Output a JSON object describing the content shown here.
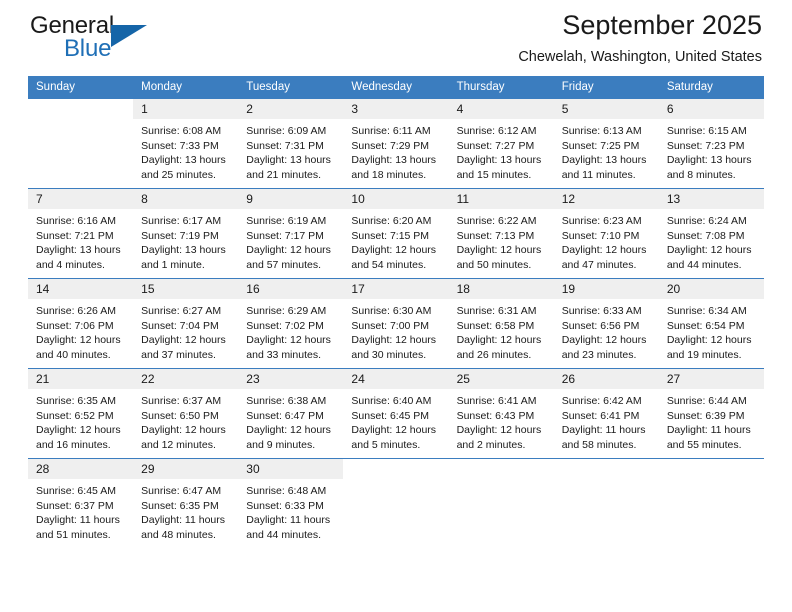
{
  "brand": {
    "name_part1": "General",
    "name_part2": "Blue",
    "logo_icon": "triangle-icon",
    "accent_color": "#1f6fb6"
  },
  "header": {
    "title": "September 2025",
    "subtitle": "Chewelah, Washington, United States"
  },
  "theme": {
    "header_blue": "#3b7dbf",
    "daynum_band": "#efefef",
    "text": "#1a1a1a"
  },
  "weekdays": [
    "Sunday",
    "Monday",
    "Tuesday",
    "Wednesday",
    "Thursday",
    "Friday",
    "Saturday"
  ],
  "labels": {
    "sunrise_prefix": "Sunrise:",
    "sunset_prefix": "Sunset:",
    "daylight_prefix": "Daylight:"
  },
  "weeks": [
    [
      {
        "day": "",
        "empty": true
      },
      {
        "day": "1",
        "sunrise": "Sunrise: 6:08 AM",
        "sunset": "Sunset: 7:33 PM",
        "daylight_line1": "Daylight: 13 hours",
        "daylight_line2": "and 25 minutes."
      },
      {
        "day": "2",
        "sunrise": "Sunrise: 6:09 AM",
        "sunset": "Sunset: 7:31 PM",
        "daylight_line1": "Daylight: 13 hours",
        "daylight_line2": "and 21 minutes."
      },
      {
        "day": "3",
        "sunrise": "Sunrise: 6:11 AM",
        "sunset": "Sunset: 7:29 PM",
        "daylight_line1": "Daylight: 13 hours",
        "daylight_line2": "and 18 minutes."
      },
      {
        "day": "4",
        "sunrise": "Sunrise: 6:12 AM",
        "sunset": "Sunset: 7:27 PM",
        "daylight_line1": "Daylight: 13 hours",
        "daylight_line2": "and 15 minutes."
      },
      {
        "day": "5",
        "sunrise": "Sunrise: 6:13 AM",
        "sunset": "Sunset: 7:25 PM",
        "daylight_line1": "Daylight: 13 hours",
        "daylight_line2": "and 11 minutes."
      },
      {
        "day": "6",
        "sunrise": "Sunrise: 6:15 AM",
        "sunset": "Sunset: 7:23 PM",
        "daylight_line1": "Daylight: 13 hours",
        "daylight_line2": "and 8 minutes."
      }
    ],
    [
      {
        "day": "7",
        "sunrise": "Sunrise: 6:16 AM",
        "sunset": "Sunset: 7:21 PM",
        "daylight_line1": "Daylight: 13 hours",
        "daylight_line2": "and 4 minutes."
      },
      {
        "day": "8",
        "sunrise": "Sunrise: 6:17 AM",
        "sunset": "Sunset: 7:19 PM",
        "daylight_line1": "Daylight: 13 hours",
        "daylight_line2": "and 1 minute."
      },
      {
        "day": "9",
        "sunrise": "Sunrise: 6:19 AM",
        "sunset": "Sunset: 7:17 PM",
        "daylight_line1": "Daylight: 12 hours",
        "daylight_line2": "and 57 minutes."
      },
      {
        "day": "10",
        "sunrise": "Sunrise: 6:20 AM",
        "sunset": "Sunset: 7:15 PM",
        "daylight_line1": "Daylight: 12 hours",
        "daylight_line2": "and 54 minutes."
      },
      {
        "day": "11",
        "sunrise": "Sunrise: 6:22 AM",
        "sunset": "Sunset: 7:13 PM",
        "daylight_line1": "Daylight: 12 hours",
        "daylight_line2": "and 50 minutes."
      },
      {
        "day": "12",
        "sunrise": "Sunrise: 6:23 AM",
        "sunset": "Sunset: 7:10 PM",
        "daylight_line1": "Daylight: 12 hours",
        "daylight_line2": "and 47 minutes."
      },
      {
        "day": "13",
        "sunrise": "Sunrise: 6:24 AM",
        "sunset": "Sunset: 7:08 PM",
        "daylight_line1": "Daylight: 12 hours",
        "daylight_line2": "and 44 minutes."
      }
    ],
    [
      {
        "day": "14",
        "sunrise": "Sunrise: 6:26 AM",
        "sunset": "Sunset: 7:06 PM",
        "daylight_line1": "Daylight: 12 hours",
        "daylight_line2": "and 40 minutes."
      },
      {
        "day": "15",
        "sunrise": "Sunrise: 6:27 AM",
        "sunset": "Sunset: 7:04 PM",
        "daylight_line1": "Daylight: 12 hours",
        "daylight_line2": "and 37 minutes."
      },
      {
        "day": "16",
        "sunrise": "Sunrise: 6:29 AM",
        "sunset": "Sunset: 7:02 PM",
        "daylight_line1": "Daylight: 12 hours",
        "daylight_line2": "and 33 minutes."
      },
      {
        "day": "17",
        "sunrise": "Sunrise: 6:30 AM",
        "sunset": "Sunset: 7:00 PM",
        "daylight_line1": "Daylight: 12 hours",
        "daylight_line2": "and 30 minutes."
      },
      {
        "day": "18",
        "sunrise": "Sunrise: 6:31 AM",
        "sunset": "Sunset: 6:58 PM",
        "daylight_line1": "Daylight: 12 hours",
        "daylight_line2": "and 26 minutes."
      },
      {
        "day": "19",
        "sunrise": "Sunrise: 6:33 AM",
        "sunset": "Sunset: 6:56 PM",
        "daylight_line1": "Daylight: 12 hours",
        "daylight_line2": "and 23 minutes."
      },
      {
        "day": "20",
        "sunrise": "Sunrise: 6:34 AM",
        "sunset": "Sunset: 6:54 PM",
        "daylight_line1": "Daylight: 12 hours",
        "daylight_line2": "and 19 minutes."
      }
    ],
    [
      {
        "day": "21",
        "sunrise": "Sunrise: 6:35 AM",
        "sunset": "Sunset: 6:52 PM",
        "daylight_line1": "Daylight: 12 hours",
        "daylight_line2": "and 16 minutes."
      },
      {
        "day": "22",
        "sunrise": "Sunrise: 6:37 AM",
        "sunset": "Sunset: 6:50 PM",
        "daylight_line1": "Daylight: 12 hours",
        "daylight_line2": "and 12 minutes."
      },
      {
        "day": "23",
        "sunrise": "Sunrise: 6:38 AM",
        "sunset": "Sunset: 6:47 PM",
        "daylight_line1": "Daylight: 12 hours",
        "daylight_line2": "and 9 minutes."
      },
      {
        "day": "24",
        "sunrise": "Sunrise: 6:40 AM",
        "sunset": "Sunset: 6:45 PM",
        "daylight_line1": "Daylight: 12 hours",
        "daylight_line2": "and 5 minutes."
      },
      {
        "day": "25",
        "sunrise": "Sunrise: 6:41 AM",
        "sunset": "Sunset: 6:43 PM",
        "daylight_line1": "Daylight: 12 hours",
        "daylight_line2": "and 2 minutes."
      },
      {
        "day": "26",
        "sunrise": "Sunrise: 6:42 AM",
        "sunset": "Sunset: 6:41 PM",
        "daylight_line1": "Daylight: 11 hours",
        "daylight_line2": "and 58 minutes."
      },
      {
        "day": "27",
        "sunrise": "Sunrise: 6:44 AM",
        "sunset": "Sunset: 6:39 PM",
        "daylight_line1": "Daylight: 11 hours",
        "daylight_line2": "and 55 minutes."
      }
    ],
    [
      {
        "day": "28",
        "sunrise": "Sunrise: 6:45 AM",
        "sunset": "Sunset: 6:37 PM",
        "daylight_line1": "Daylight: 11 hours",
        "daylight_line2": "and 51 minutes."
      },
      {
        "day": "29",
        "sunrise": "Sunrise: 6:47 AM",
        "sunset": "Sunset: 6:35 PM",
        "daylight_line1": "Daylight: 11 hours",
        "daylight_line2": "and 48 minutes."
      },
      {
        "day": "30",
        "sunrise": "Sunrise: 6:48 AM",
        "sunset": "Sunset: 6:33 PM",
        "daylight_line1": "Daylight: 11 hours",
        "daylight_line2": "and 44 minutes."
      },
      {
        "day": "",
        "empty": true
      },
      {
        "day": "",
        "empty": true
      },
      {
        "day": "",
        "empty": true
      },
      {
        "day": "",
        "empty": true
      }
    ]
  ]
}
